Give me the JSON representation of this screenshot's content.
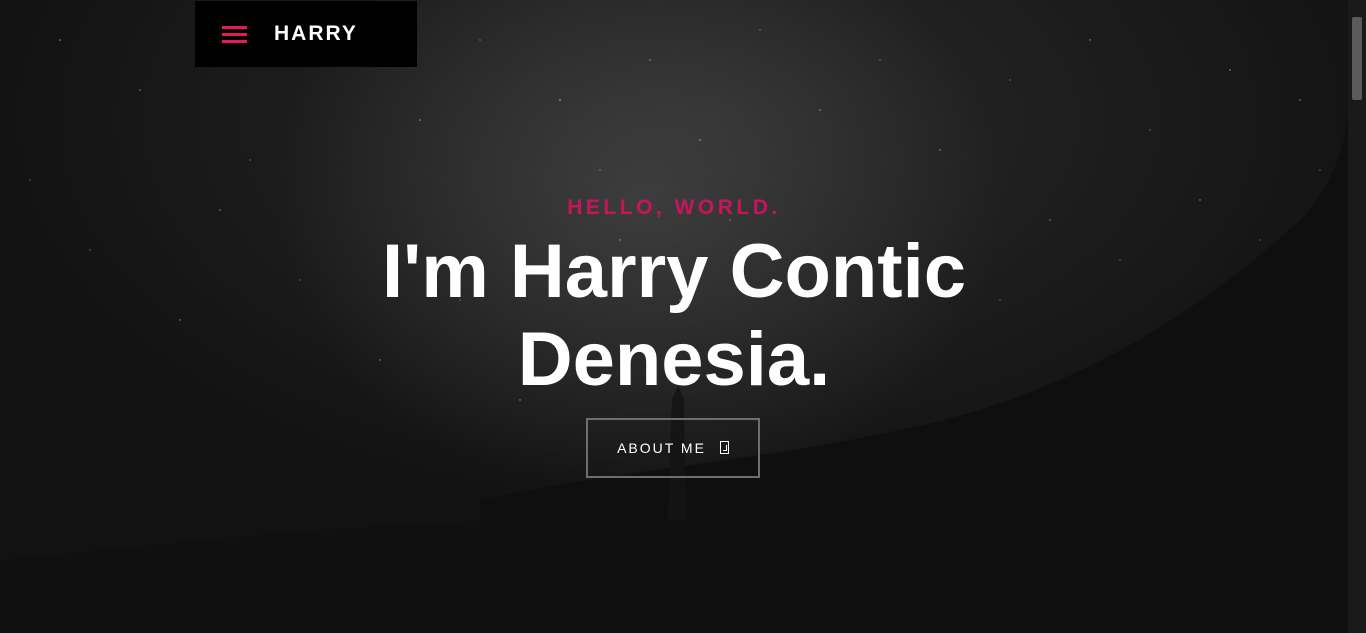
{
  "nav": {
    "brand": "HARRY"
  },
  "hero": {
    "greeting": "HELLO, WORLD.",
    "headline_line1": "I'm Harry Contic",
    "headline_line2": "Denesia.",
    "cta_label": "ABOUT ME"
  },
  "colors": {
    "accent": "#c8145a",
    "background": "#111111",
    "text": "#ffffff"
  },
  "icons": {
    "menu": "hamburger-icon",
    "cta": "arrow-down-icon"
  }
}
